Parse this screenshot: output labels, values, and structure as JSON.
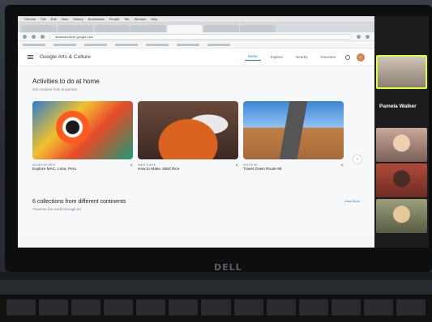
{
  "browser": {
    "mac_menu": [
      "Chrome",
      "File",
      "Edit",
      "View",
      "History",
      "Bookmarks",
      "People",
      "Tab",
      "Window",
      "Help"
    ],
    "url": "artsandculture.google.com"
  },
  "site": {
    "title": "Google Arts & Culture",
    "nav": [
      {
        "label": "Home",
        "selected": true
      },
      {
        "label": "Explore",
        "selected": false
      },
      {
        "label": "Nearby",
        "selected": false
      },
      {
        "label": "Favorites",
        "selected": false
      }
    ]
  },
  "main": {
    "section_title": "Activities to do at home",
    "section_sub": "Get creative from anywhere",
    "cards": [
      {
        "kicker": "Museo de Arte",
        "title": "Explore MAC, Lima, Peru",
        "image": "painting"
      },
      {
        "kicker": "Make a dish",
        "title": "How to Make Jollof Rice",
        "image": "rice"
      },
      {
        "kicker": "Route 66",
        "title": "Travel Down Route 66",
        "image": "road"
      }
    ],
    "section2_title": "6 collections from different continents",
    "section2_sub": "Traverse the world through art",
    "view_more": "View More"
  },
  "zoom": {
    "host_name": "Pamela Walker"
  },
  "laptop": {
    "brand": "DELL"
  }
}
